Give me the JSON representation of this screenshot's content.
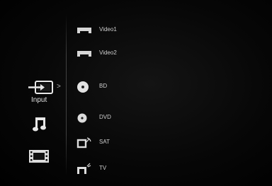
{
  "categories": {
    "input": {
      "label": "Input",
      "icon": "input-icon"
    },
    "music": {
      "icon": "music-note-icon"
    },
    "video": {
      "icon": "film-strip-icon"
    }
  },
  "submenu_indicator": ">",
  "items": [
    {
      "label": "Video1",
      "icon": "video-input-port-icon"
    },
    {
      "label": "Video2",
      "icon": "video-input-port-icon"
    },
    {
      "label": "BD",
      "icon": "disc-icon"
    },
    {
      "label": "DVD",
      "icon": "disc-icon"
    },
    {
      "label": "SAT",
      "icon": "satellite-tv-icon"
    },
    {
      "label": "TV",
      "icon": "tv-antenna-icon"
    }
  ],
  "colors": {
    "background": "#000000",
    "text": "#cfcfcf"
  }
}
